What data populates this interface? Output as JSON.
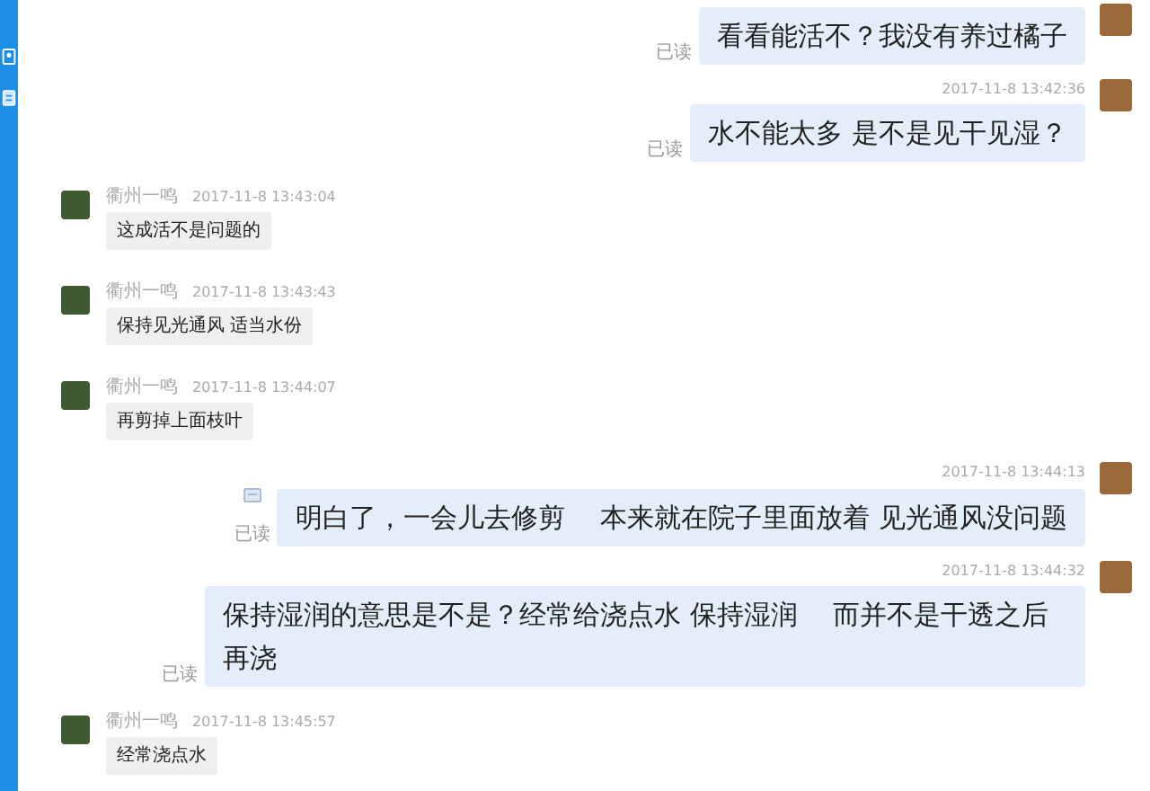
{
  "messages": [
    {
      "kind": "sent",
      "text": "看看能活不？我没有养过橘子",
      "read": "已读",
      "flag_icon": false
    },
    {
      "kind": "sent",
      "time": "2017-11-8 13:42:36",
      "text": "水不能太多 是不是见干见湿？",
      "read": "已读",
      "flag_icon": false
    },
    {
      "kind": "received",
      "name": "衢州一鸣",
      "time": "2017-11-8 13:43:04",
      "text": "这成活不是问题的"
    },
    {
      "kind": "received",
      "name": "衢州一鸣",
      "time": "2017-11-8 13:43:43",
      "text": "保持见光通风 适当水份"
    },
    {
      "kind": "received",
      "name": "衢州一鸣",
      "time": "2017-11-8 13:44:07",
      "text": "再剪掉上面枝叶"
    },
    {
      "kind": "sent",
      "time": "2017-11-8 13:44:13",
      "text": "明白了，一会儿去修剪　 本来就在院子里面放着 见光通风没问题",
      "read": "已读",
      "flag_icon": true
    },
    {
      "kind": "sent",
      "time": "2017-11-8 13:44:32",
      "text": "保持湿润的意思是不是？经常给浇点水 保持湿润　 而并不是干透之后再浇",
      "read": "已读",
      "flag_icon": false
    },
    {
      "kind": "received",
      "name": "衢州一鸣",
      "time": "2017-11-8 13:45:57",
      "text": "经常浇点水"
    }
  ]
}
